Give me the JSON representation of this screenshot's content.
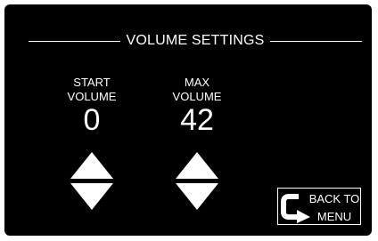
{
  "screen": {
    "title": "VOLUME SETTINGS",
    "background_color": "#000000",
    "foreground_color": "#ffffff"
  },
  "start_volume": {
    "label_line1": "START",
    "label_line2": "VOLUME",
    "value": "0",
    "up_icon": "triangle-up",
    "down_icon": "triangle-down"
  },
  "max_volume": {
    "label_line1": "MAX",
    "label_line2": "VOLUME",
    "value": "42",
    "up_icon": "triangle-up",
    "down_icon": "triangle-down"
  },
  "back_button": {
    "line1": "BACK TO",
    "line2": "MENU",
    "icon": "return-arrow"
  }
}
